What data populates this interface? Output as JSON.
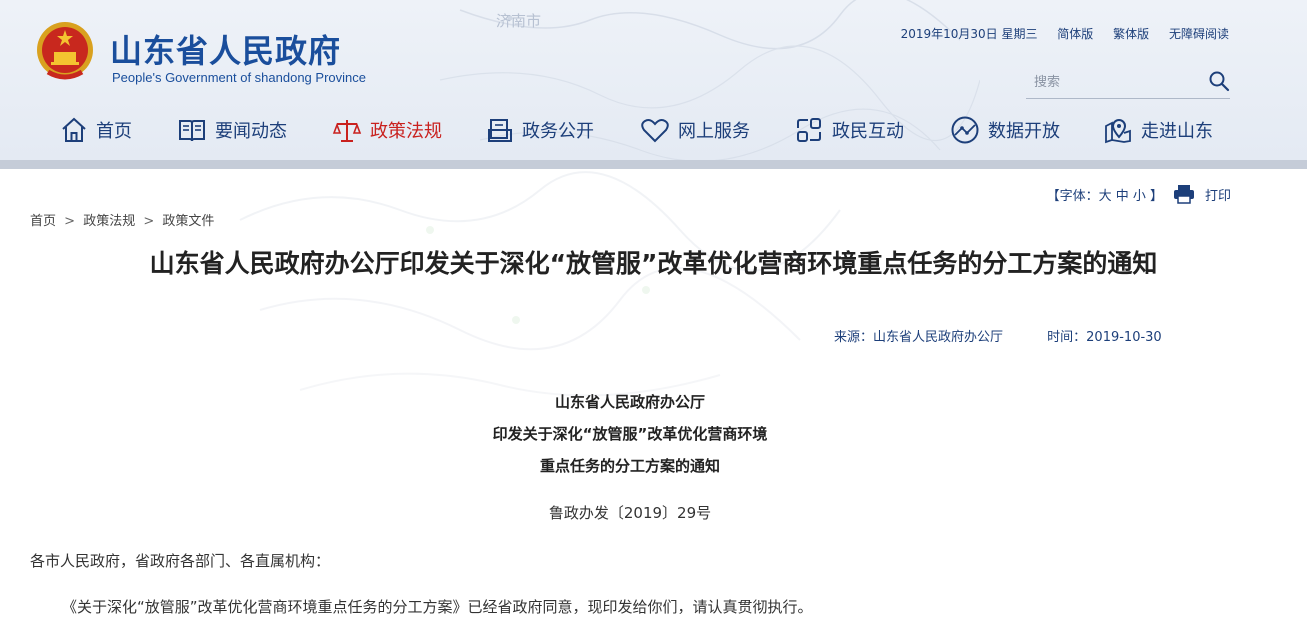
{
  "site": {
    "title": "山东省人民政府",
    "subtitle": "People's Government of shandong Province"
  },
  "top_links": {
    "date": "2019年10月30日 星期三",
    "simplified": "简体版",
    "traditional": "繁体版",
    "accessible": "无障碍阅读"
  },
  "search": {
    "placeholder": "搜索"
  },
  "map_labels": {
    "city": "济南市"
  },
  "nav": {
    "items": [
      {
        "label": "首页",
        "icon": "home-icon"
      },
      {
        "label": "要闻动态",
        "icon": "newspaper-icon"
      },
      {
        "label": "政策法规",
        "icon": "scales-icon"
      },
      {
        "label": "政务公开",
        "icon": "folder-icon"
      },
      {
        "label": "网上服务",
        "icon": "heart-icon"
      },
      {
        "label": "政民互动",
        "icon": "exchange-icon"
      },
      {
        "label": "数据开放",
        "icon": "globe-icon"
      },
      {
        "label": "走进山东",
        "icon": "map-pin-icon"
      }
    ],
    "active_index": 2,
    "active_color": "#c9211e",
    "text_color": "#1d3f7a"
  },
  "font_size_control": {
    "label": "【字体：大 中 小 】",
    "print": "打印"
  },
  "breadcrumb": {
    "items": [
      "首页",
      "政策法规",
      "政策文件"
    ],
    "separator": ">"
  },
  "article": {
    "title": "山东省人民政府办公厅印发关于深化“放管服”改革优化营商环境重点任务的分工方案的通知",
    "source": "来源：山东省人民政府办公厅",
    "time": "时间：2019-10-30",
    "doc_heading": [
      "山东省人民政府办公厅",
      "印发关于深化“放管服”改革优化营商环境",
      "重点任务的分工方案的通知"
    ],
    "doc_number": "鲁政办发〔2019〕29号",
    "salutation": "各市人民政府，省政府各部门、各直属机构：",
    "body": "《关于深化“放管服”改革优化营商环境重点任务的分工方案》已经省政府同意，现印发给你们，请认真贯彻执行。"
  },
  "colors": {
    "brand_blue": "#1a4e9c",
    "header_bg": "#e8edf5"
  }
}
